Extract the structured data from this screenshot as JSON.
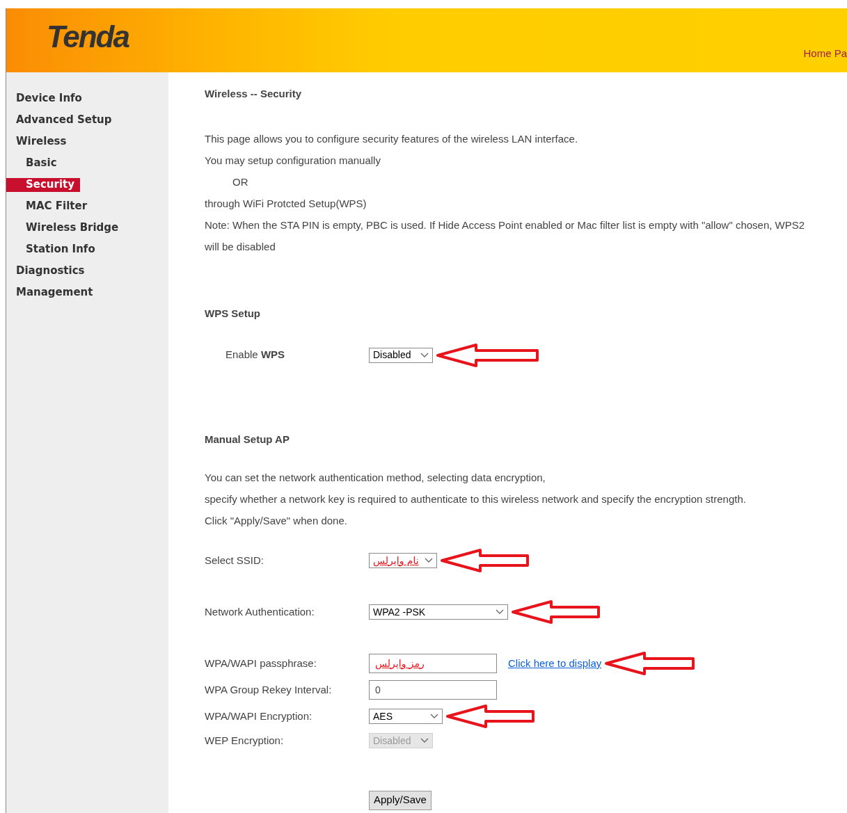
{
  "header": {
    "logo": "Tenda",
    "link": "Home Pa"
  },
  "sidebar": {
    "items": [
      {
        "label": "Device Info",
        "selected": false
      },
      {
        "label": "Advanced Setup",
        "selected": false
      },
      {
        "label": "Wireless",
        "selected": false,
        "children": [
          {
            "label": "Basic",
            "selected": false
          },
          {
            "label": "Security",
            "selected": true
          },
          {
            "label": "MAC Filter",
            "selected": false
          },
          {
            "label": "Wireless Bridge",
            "selected": false
          },
          {
            "label": "Station Info",
            "selected": false
          }
        ]
      },
      {
        "label": "Diagnostics",
        "selected": false
      },
      {
        "label": "Management",
        "selected": false
      }
    ]
  },
  "page_title": "Wireless -- Security",
  "intro": [
    "This page allows you to configure security features of the wireless LAN interface.",
    "You may setup configuration manually",
    "OR",
    "through WiFi Protcted Setup(WPS)",
    "Note: When the STA PIN is empty, PBC is used. If Hide Access Point enabled or Mac filter list is empty with \"allow\" chosen, WPS2 will be disabled"
  ],
  "wps": {
    "heading": "WPS Setup",
    "label": "Enable **WPS**",
    "value": "Disabled",
    "annotated": true
  },
  "manual": {
    "heading": "Manual Setup AP",
    "description": [
      "You can set the network authentication method, selecting data encryption,",
      "specify whether a network key is required to authenticate to this wireless network and specify the encryption strength.",
      "Click \"Apply/Save\" when done."
    ]
  },
  "fields": [
    {
      "label": "Select SSID:",
      "kind": "select",
      "value": "نام وایرلس",
      "rtl": true,
      "disabled": false,
      "annotated": true
    },
    {
      "label": "Network Authentication:",
      "kind": "select",
      "value": "WPA2 -PSK",
      "rtl": false,
      "disabled": false,
      "annotated": true
    },
    {
      "label": "WPA/WAPI passphrase:",
      "kind": "text",
      "value": "رمز وایرلس",
      "rtl": true,
      "disabled": false,
      "annotated": true,
      "link": "Click here to display"
    },
    {
      "label": "WPA Group Rekey Interval:",
      "kind": "text",
      "value": "0",
      "rtl": false,
      "disabled": false,
      "annotated": false
    },
    {
      "label": "WPA/WAPI Encryption:",
      "kind": "select",
      "value": "AES",
      "rtl": false,
      "disabled": false,
      "annotated": true
    },
    {
      "label": "WEP Encryption:",
      "kind": "select",
      "value": "Disabled",
      "rtl": false,
      "disabled": true,
      "annotated": false
    }
  ],
  "apply_button": "Apply/Save"
}
